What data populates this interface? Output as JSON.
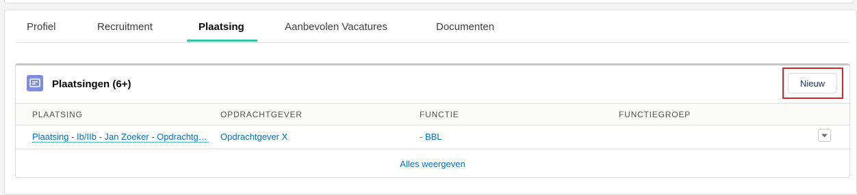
{
  "tabs": [
    {
      "label": "Profiel"
    },
    {
      "label": "Recruitment"
    },
    {
      "label": "Plaatsing",
      "active": true
    },
    {
      "label": "Aanbevolen Vacatures"
    },
    {
      "label": "Documenten"
    }
  ],
  "related_list": {
    "icon": "list-icon",
    "title": "Plaatsingen (6+)",
    "new_button": "Nieuw",
    "columns": [
      "PLAATSING",
      "OPDRACHTGEVER",
      "FUNCTIE",
      "FUNCTIEGROEP"
    ],
    "rows": [
      {
        "plaatsing": "Plaatsing - Ib/IIb - Jan Zoeker - Opdrachtgever X",
        "opdrachtgever": "Opdrachtgever X",
        "functie": "- BBL",
        "functiegroep": ""
      }
    ],
    "view_all": "Alles weergeven"
  },
  "colors": {
    "accent_tab": "#35c4a6",
    "link": "#006dcc",
    "list_icon_bg": "#7f8de1",
    "highlight": "#d8232a"
  }
}
